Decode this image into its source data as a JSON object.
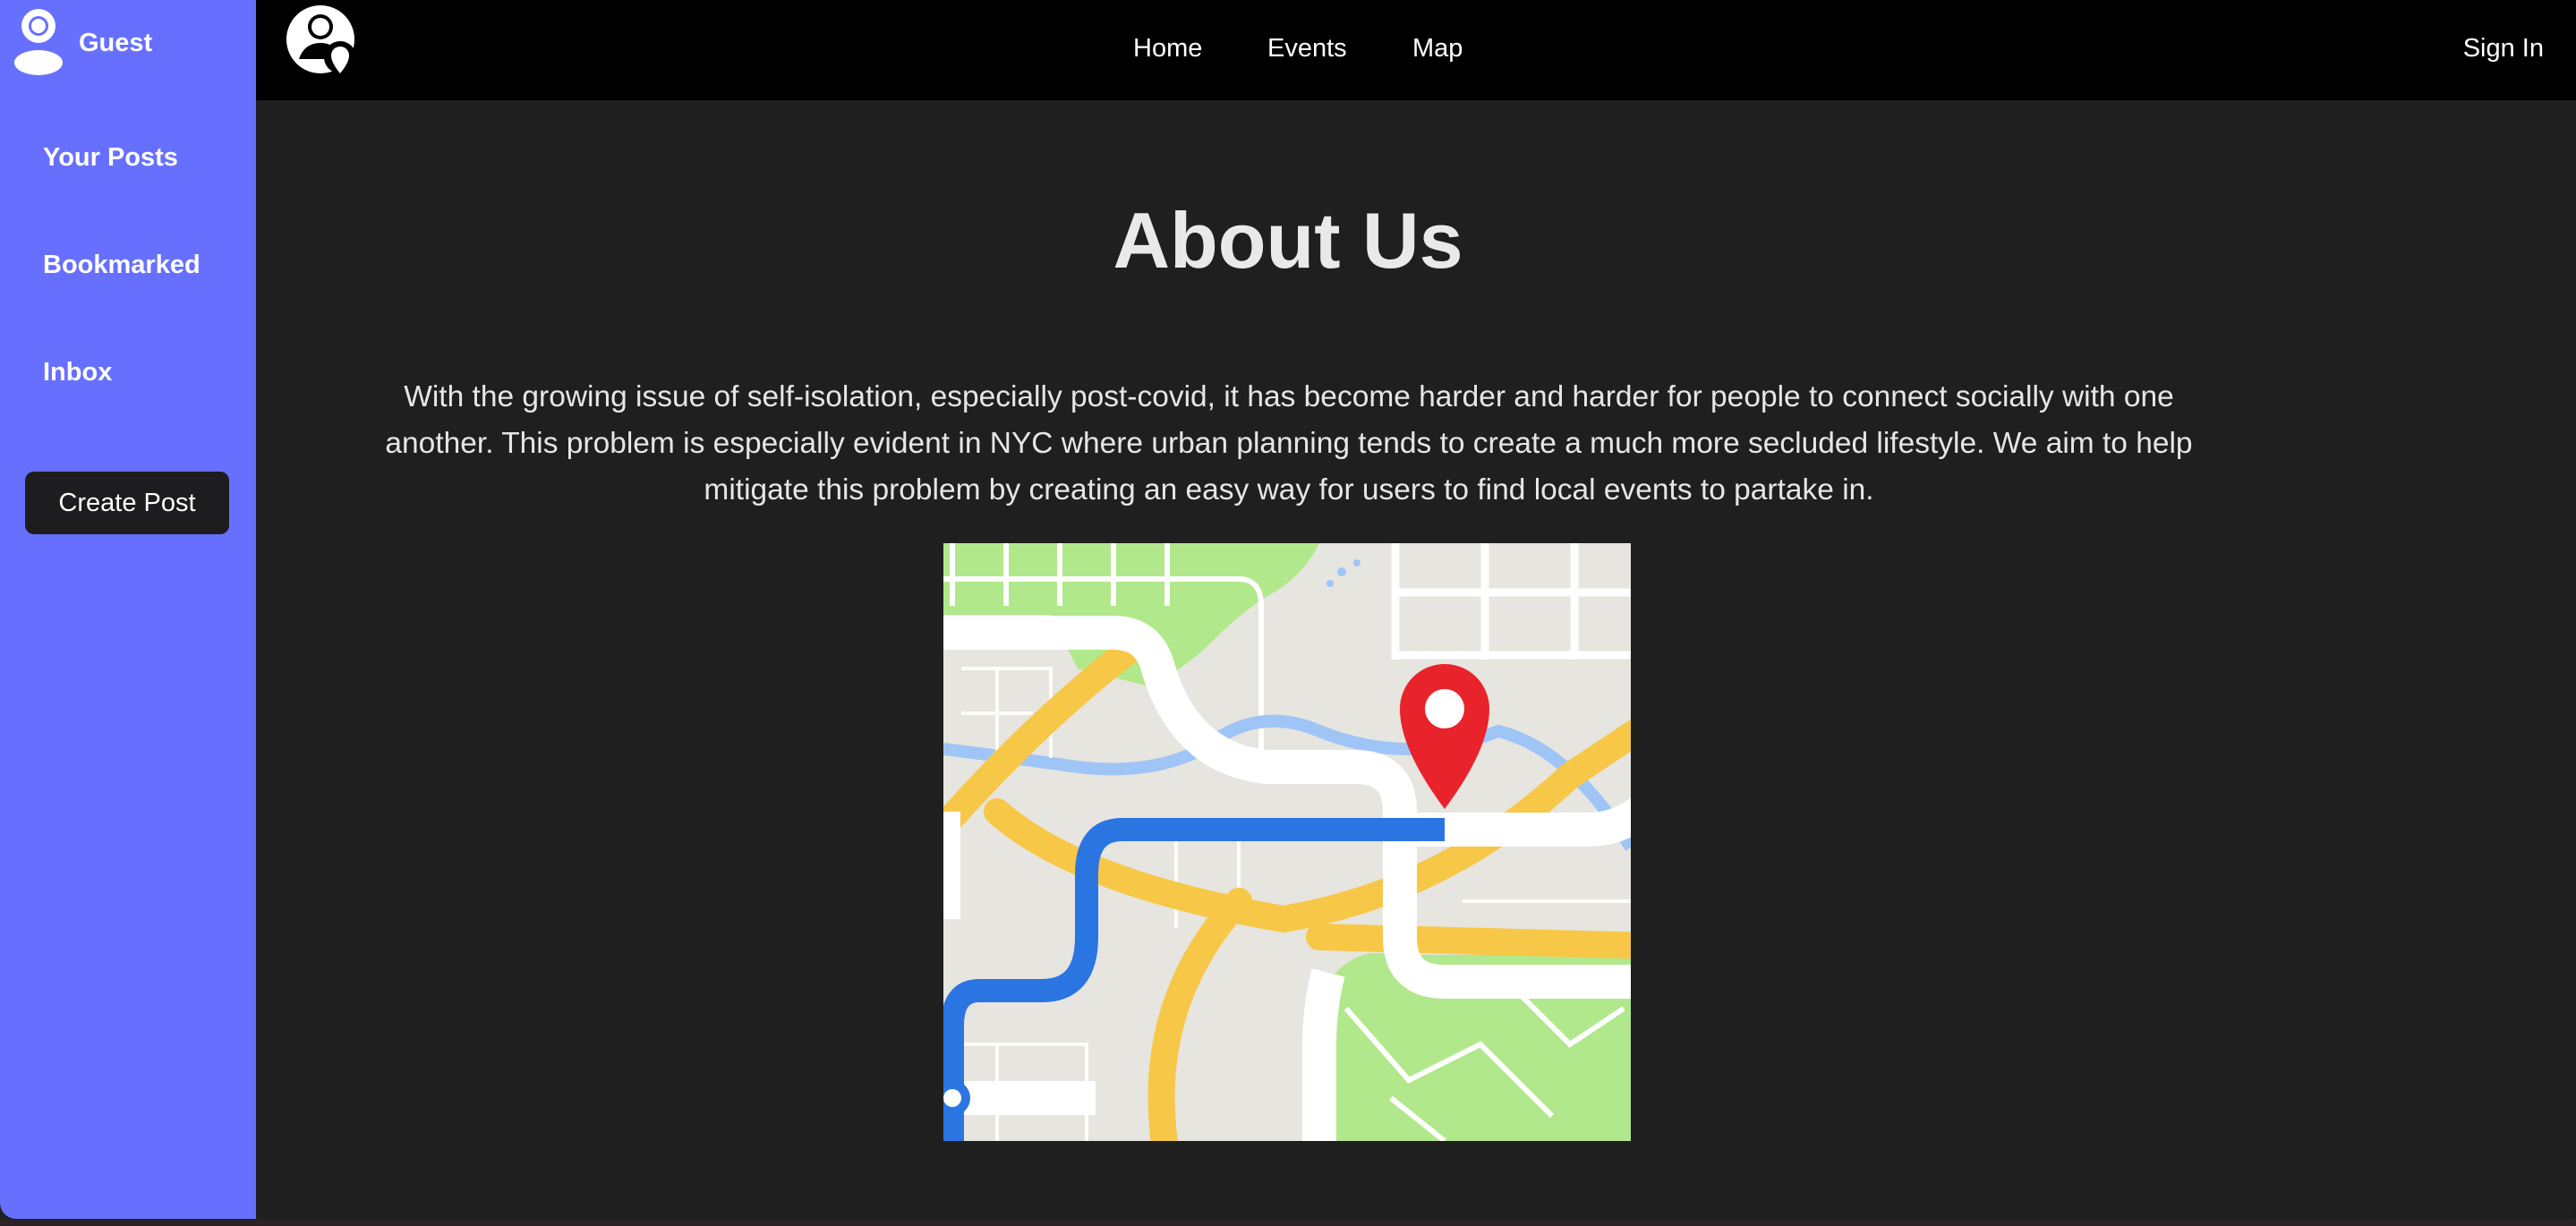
{
  "sidebar": {
    "user_icon": "user-avatar-icon",
    "user_name": "Guest",
    "items": [
      {
        "label": "Your Posts"
      },
      {
        "label": "Bookmarked"
      },
      {
        "label": "Inbox"
      }
    ],
    "create_post_label": "Create Post",
    "background_color": "#6770fe"
  },
  "header": {
    "logo_icon": "community-logo-icon",
    "nav": [
      {
        "label": "Home"
      },
      {
        "label": "Events"
      },
      {
        "label": "Map"
      }
    ],
    "sign_in_label": "Sign In"
  },
  "main": {
    "title": "About Us",
    "description": "With the growing issue of self-isolation, especially post-covid, it has become harder and harder for people to connect socially with one another. This problem is especially evident in NYC where urban planning tends to create a much more secluded lifestyle. We aim to help mitigate this problem by creating an easy way for users to find local events to partake in.",
    "image_icon": "map-route-illustration"
  }
}
